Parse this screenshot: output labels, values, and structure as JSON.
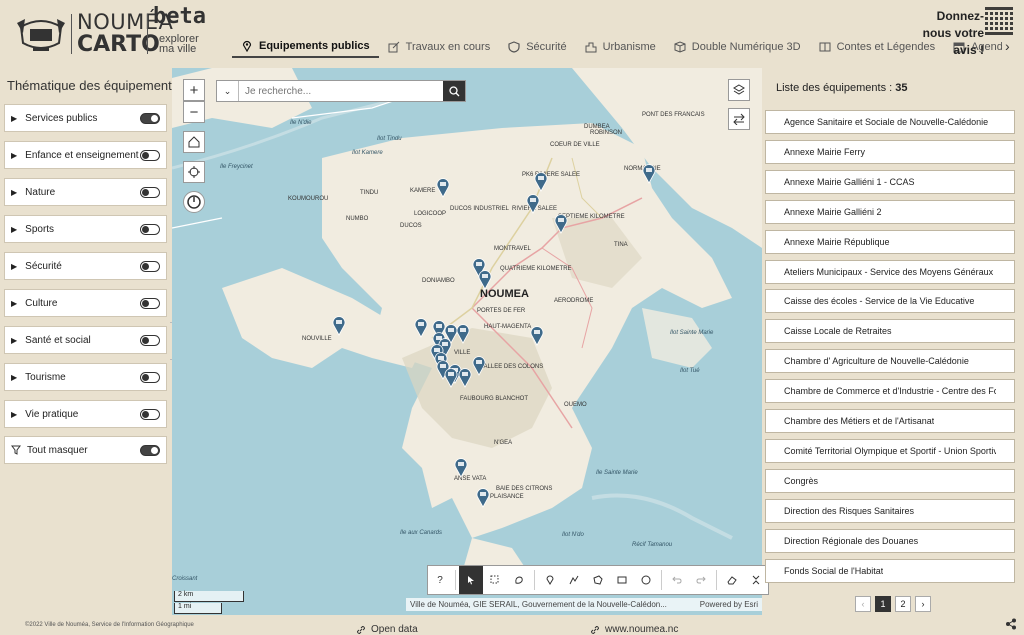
{
  "header": {
    "logo_line1": "NOUMÉA",
    "logo_line2": "CARTO",
    "beta": "beta",
    "tagline": "explorer ma ville",
    "feedback": "Donnez-nous votre avis !",
    "tabs": [
      {
        "label": "Equipements publics",
        "icon": "map-pin-icon",
        "active": true
      },
      {
        "label": "Travaux en cours",
        "icon": "edit-icon",
        "active": false
      },
      {
        "label": "Sécurité",
        "icon": "shield-icon",
        "active": false
      },
      {
        "label": "Urbanisme",
        "icon": "building-icon",
        "active": false
      },
      {
        "label": "Double Numérique 3D",
        "icon": "cube-icon",
        "active": false
      },
      {
        "label": "Contes et Légendes",
        "icon": "book-icon",
        "active": false
      },
      {
        "label": "Agenda de",
        "icon": "calendar-icon",
        "active": false
      }
    ],
    "tab_next": "›"
  },
  "left_panel": {
    "title": "Thématique des équipements",
    "categories": [
      {
        "label": "Services publics",
        "on": true
      },
      {
        "label": "Enfance et enseignement",
        "on": false
      },
      {
        "label": "Nature",
        "on": false
      },
      {
        "label": "Sports",
        "on": false
      },
      {
        "label": "Sécurité",
        "on": false
      },
      {
        "label": "Culture",
        "on": false
      },
      {
        "label": "Santé et social",
        "on": false
      },
      {
        "label": "Tourisme",
        "on": false
      },
      {
        "label": "Vie pratique",
        "on": false
      }
    ],
    "hide_all": {
      "label": "Tout masquer",
      "on": true
    },
    "copyright": "©2022 Ville de Nouméa, Service de l'Information Géographique"
  },
  "map": {
    "search_placeholder": "Je recherche...",
    "zoom_in": "+",
    "zoom_out": "−",
    "help": "?",
    "scale_km": "2 km",
    "scale_mi": "1 mi",
    "attribution": "Ville de Nouméa, GIE SERAIL, Gouvernement de la Nouvelle-Calédon...",
    "powered_by": "Powered by Esri",
    "labels": [
      {
        "text": "NOUMEA",
        "style": "big"
      },
      {
        "text": "Ile N'die",
        "style": "ital"
      },
      {
        "text": "Ilot Tindu",
        "style": "ital"
      },
      {
        "text": "Ilot Kamere",
        "style": "ital"
      },
      {
        "text": "Ile Freycinet",
        "style": "ital"
      },
      {
        "text": "PK6 RIVIERE SALEE",
        "style": ""
      },
      {
        "text": "PONT DES FRANCAIS",
        "style": ""
      },
      {
        "text": "COEUR DE VILLE",
        "style": ""
      },
      {
        "text": "DUMBEA",
        "style": ""
      },
      {
        "text": "ROBINSON",
        "style": ""
      },
      {
        "text": "NORMANDIE",
        "style": ""
      },
      {
        "text": "KAMERE",
        "style": ""
      },
      {
        "text": "TINDU",
        "style": ""
      },
      {
        "text": "KOUMOUROU",
        "style": ""
      },
      {
        "text": "NUMBO",
        "style": ""
      },
      {
        "text": "LOGICOOP",
        "style": ""
      },
      {
        "text": "DUCOS",
        "style": ""
      },
      {
        "text": "DUCOS INDUSTRIEL",
        "style": ""
      },
      {
        "text": "RIVIERE SALEE",
        "style": ""
      },
      {
        "text": "MONTRAVEL",
        "style": ""
      },
      {
        "text": "SEPTIEME KILOMETRE",
        "style": ""
      },
      {
        "text": "TINA",
        "style": ""
      },
      {
        "text": "QUATRIEME KILOMETRE",
        "style": ""
      },
      {
        "text": "DONIAMBO",
        "style": ""
      },
      {
        "text": "AERODROME",
        "style": ""
      },
      {
        "text": "PORTES DE FER",
        "style": ""
      },
      {
        "text": "HAUT-MAGENTA",
        "style": ""
      },
      {
        "text": "NOUVILLE",
        "style": ""
      },
      {
        "text": "VILLE",
        "style": ""
      },
      {
        "text": "VALLEE DES COLONS",
        "style": ""
      },
      {
        "text": "FAUBOURG BLANCHOT",
        "style": ""
      },
      {
        "text": "OUEMO",
        "style": ""
      },
      {
        "text": "Ilot Sainte Marie",
        "style": "ital"
      },
      {
        "text": "Ilot Tué",
        "style": "ital"
      },
      {
        "text": "N'GEA",
        "style": ""
      },
      {
        "text": "Ile Sainte Marie",
        "style": "ital"
      },
      {
        "text": "ANSE VATA",
        "style": ""
      },
      {
        "text": "BAIE DES CITRONS",
        "style": ""
      },
      {
        "text": "PLAISANCE",
        "style": ""
      },
      {
        "text": "Ile aux Canards",
        "style": "ital"
      },
      {
        "text": "Ilot N'do",
        "style": "ital"
      },
      {
        "text": "Récif Tamanou",
        "style": "ital"
      },
      {
        "text": "Croissant",
        "style": "ital"
      }
    ]
  },
  "right_panel": {
    "title_prefix": "Liste des équipements :",
    "count": "35",
    "items": [
      "Agence Sanitaire et Sociale de Nouvelle-Calédonie",
      "Annexe Mairie Ferry",
      "Annexe Mairie Galliéni 1 - CCAS",
      "Annexe Mairie Galliéni 2",
      "Annexe Mairie République",
      "Ateliers Municipaux - Service des Moyens Généraux",
      "Caisse des écoles - Service de la Vie Educative",
      "Caisse Locale de Retraites",
      "Chambre d' Agriculture de Nouvelle-Calédonie",
      "Chambre de Commerce et d'Industrie - Centre des Formalités des Entreprises",
      "Chambre des Métiers et de l'Artisanat",
      "Comité Territorial Olympique et Sportif - Union Sportive",
      "Congrès",
      "Direction des Risques Sanitaires",
      "Direction Régionale des Douanes",
      "Fonds Social de l'Habitat"
    ],
    "pages": [
      "1",
      "2"
    ],
    "current_page": "1",
    "prev": "‹",
    "next": "›"
  },
  "footer": {
    "open_data": "Open data",
    "website": "www.noumea.nc"
  },
  "colors": {
    "background": "#e9e1cf",
    "sea": "#a8cfd9",
    "land": "#f1ece0",
    "pin": "#3f6a8a",
    "dark": "#333333"
  }
}
